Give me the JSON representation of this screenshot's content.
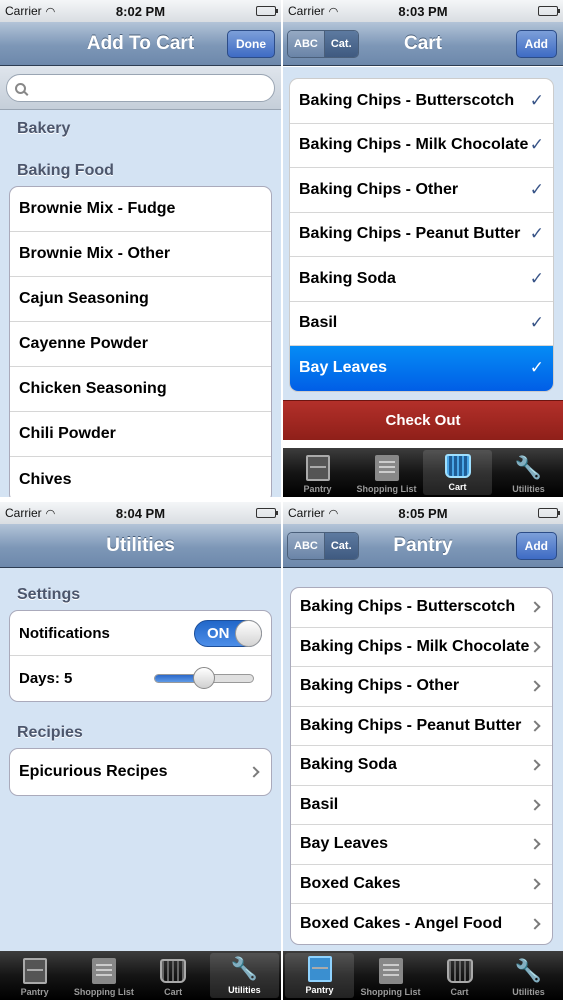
{
  "screens": [
    {
      "status": {
        "carrier": "Carrier",
        "time": "8:02 PM"
      },
      "nav": {
        "title": "Add To Cart",
        "right_button": "Done"
      },
      "search": {
        "placeholder": ""
      },
      "sections": [
        {
          "header": "Bakery",
          "items": []
        },
        {
          "header": "Baking Food",
          "items": [
            "Brownie Mix - Fudge",
            "Brownie Mix - Other",
            "Cajun Seasoning",
            "Cayenne Powder",
            "Chicken Seasoning",
            "Chili Powder",
            "Chives"
          ]
        }
      ]
    },
    {
      "status": {
        "carrier": "Carrier",
        "time": "8:03 PM"
      },
      "nav": {
        "title": "Cart",
        "seg_left": "ABC",
        "seg_right": "Cat.",
        "right_button": "Add"
      },
      "items": [
        {
          "label": "Baking Chips - Butterscotch",
          "checked": true,
          "selected": false
        },
        {
          "label": "Baking Chips - Milk Chocolate",
          "checked": true,
          "selected": false
        },
        {
          "label": "Baking Chips - Other",
          "checked": true,
          "selected": false
        },
        {
          "label": "Baking Chips - Peanut Butter",
          "checked": true,
          "selected": false
        },
        {
          "label": "Baking Soda",
          "checked": true,
          "selected": false
        },
        {
          "label": "Basil",
          "checked": true,
          "selected": false
        },
        {
          "label": "Bay Leaves",
          "checked": true,
          "selected": true
        }
      ],
      "checkmark": "✓",
      "checkout_label": "Check Out",
      "tabs": [
        "Pantry",
        "Shopping List",
        "Cart",
        "Utilities"
      ],
      "active_tab": 2
    },
    {
      "status": {
        "carrier": "Carrier",
        "time": "8:04 PM"
      },
      "nav": {
        "title": "Utilities"
      },
      "settings_header": "Settings",
      "notifications_label": "Notifications",
      "notifications_state": "ON",
      "days_label": "Days: 5",
      "days_slider_fraction": 0.5,
      "recipes_header": "Recipies",
      "recipes_item": "Epicurious Recipes",
      "tabs": [
        "Pantry",
        "Shopping List",
        "Cart",
        "Utilities"
      ],
      "active_tab": 3
    },
    {
      "status": {
        "carrier": "Carrier",
        "time": "8:05 PM"
      },
      "nav": {
        "title": "Pantry",
        "seg_left": "ABC",
        "seg_right": "Cat.",
        "right_button": "Add"
      },
      "items": [
        "Baking Chips - Butterscotch",
        "Baking Chips - Milk Chocolate",
        "Baking Chips - Other",
        "Baking Chips - Peanut Butter",
        "Baking Soda",
        "Basil",
        "Bay Leaves",
        "Boxed Cakes",
        "Boxed Cakes - Angel Food"
      ],
      "tabs": [
        "Pantry",
        "Shopping List",
        "Cart",
        "Utilities"
      ],
      "active_tab": 0
    }
  ],
  "colors": {
    "nav_button": "#3e6bc4",
    "selection": "#015ee6",
    "checkout": "#a02822",
    "check": "#385487",
    "group_bg": "#d4e3f3"
  },
  "icons": {
    "tab_icons": [
      "pantry-icon",
      "shopping-list-icon",
      "cart-icon",
      "wrench-icon"
    ]
  }
}
